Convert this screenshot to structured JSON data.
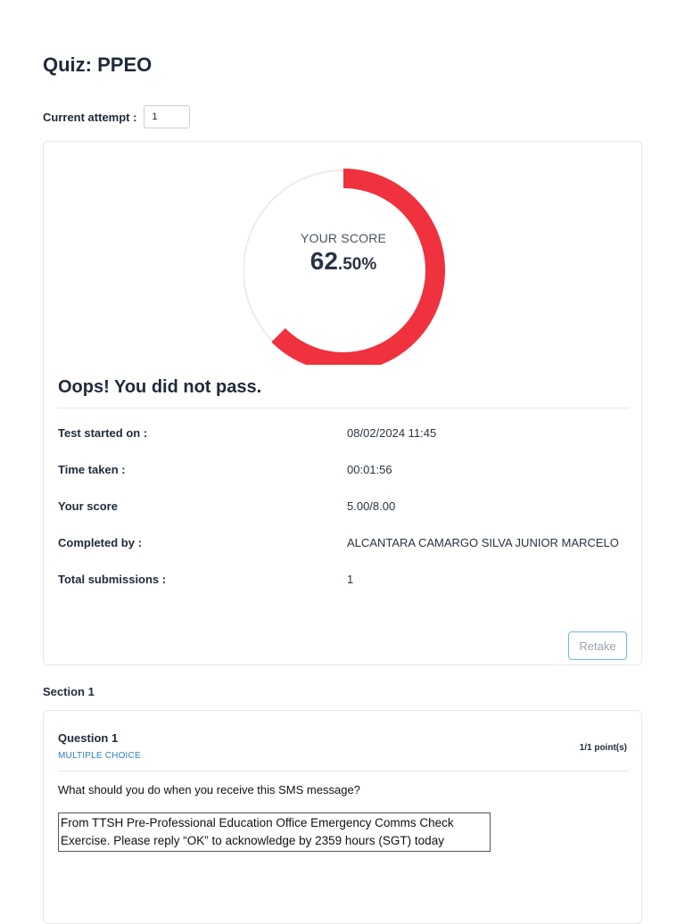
{
  "page": {
    "title": "Quiz: PPEO"
  },
  "attempt": {
    "label": "Current attempt :",
    "value": "1"
  },
  "score": {
    "label": "YOUR SCORE",
    "integer": "62",
    "fraction": ".50%",
    "percent": 62.5,
    "ring_color": "#f0313e",
    "track_color": "#ececec"
  },
  "result": {
    "message": "Oops! You did not pass."
  },
  "details": [
    {
      "label": "Test started on :",
      "value": "08/02/2024 11:45"
    },
    {
      "label": "Time taken :",
      "value": "00:01:56"
    },
    {
      "label": "Your score",
      "value": "5.00/8.00"
    },
    {
      "label": "Completed by :",
      "value": "ALCANTARA CAMARGO SILVA JUNIOR MARCELO"
    },
    {
      "label": "Total submissions :",
      "value": "1"
    }
  ],
  "actions": {
    "retake_label": "Retake"
  },
  "section": {
    "title": "Section 1"
  },
  "question": {
    "title": "Question 1",
    "type": "MULTIPLE CHOICE",
    "points": "1/1 point(s)",
    "text": "What should you do when you receive this SMS message?",
    "sms_line1": "From TTSH Pre-Professional Education Office Emergency Comms Check",
    "sms_line2": "Exercise. Please reply “OK” to acknowledge by 2359 hours (SGT) today"
  }
}
